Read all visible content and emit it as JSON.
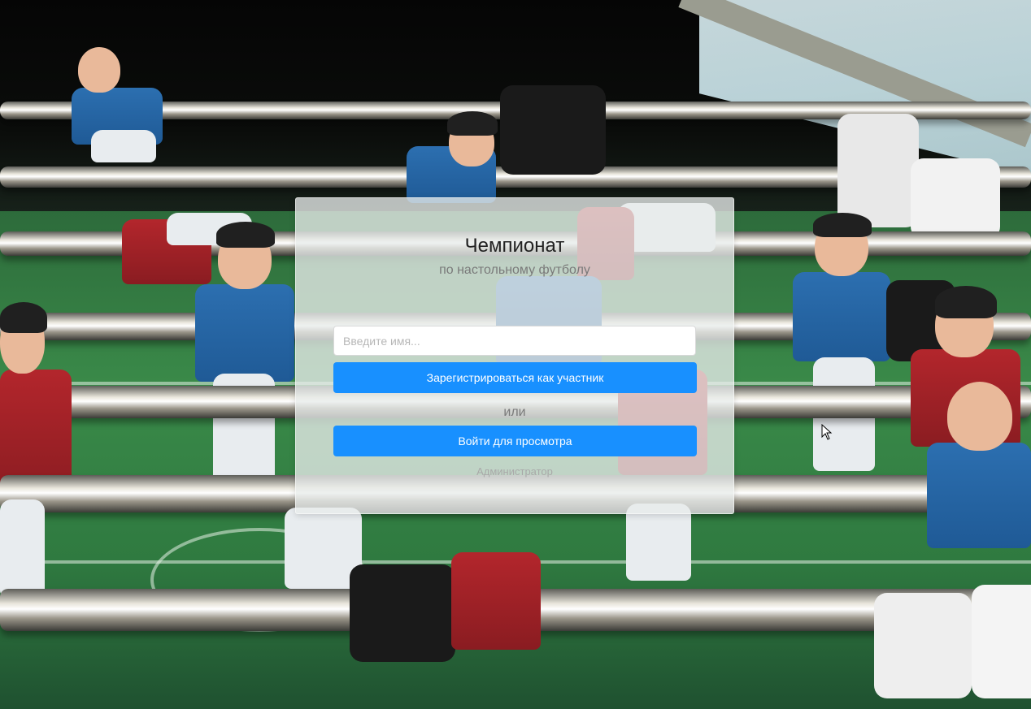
{
  "card": {
    "title": "Чемпионат",
    "subtitle": "по настольному футболу",
    "name_input": {
      "placeholder": "Введите имя...",
      "value": ""
    },
    "register_button": "Зарегистрироваться как участник",
    "or_text": "или",
    "view_button": "Войти для просмотра",
    "admin_link": "Администратор"
  },
  "colors": {
    "primary": "#1890ff",
    "card_bg": "rgba(232,236,234,0.78)"
  }
}
